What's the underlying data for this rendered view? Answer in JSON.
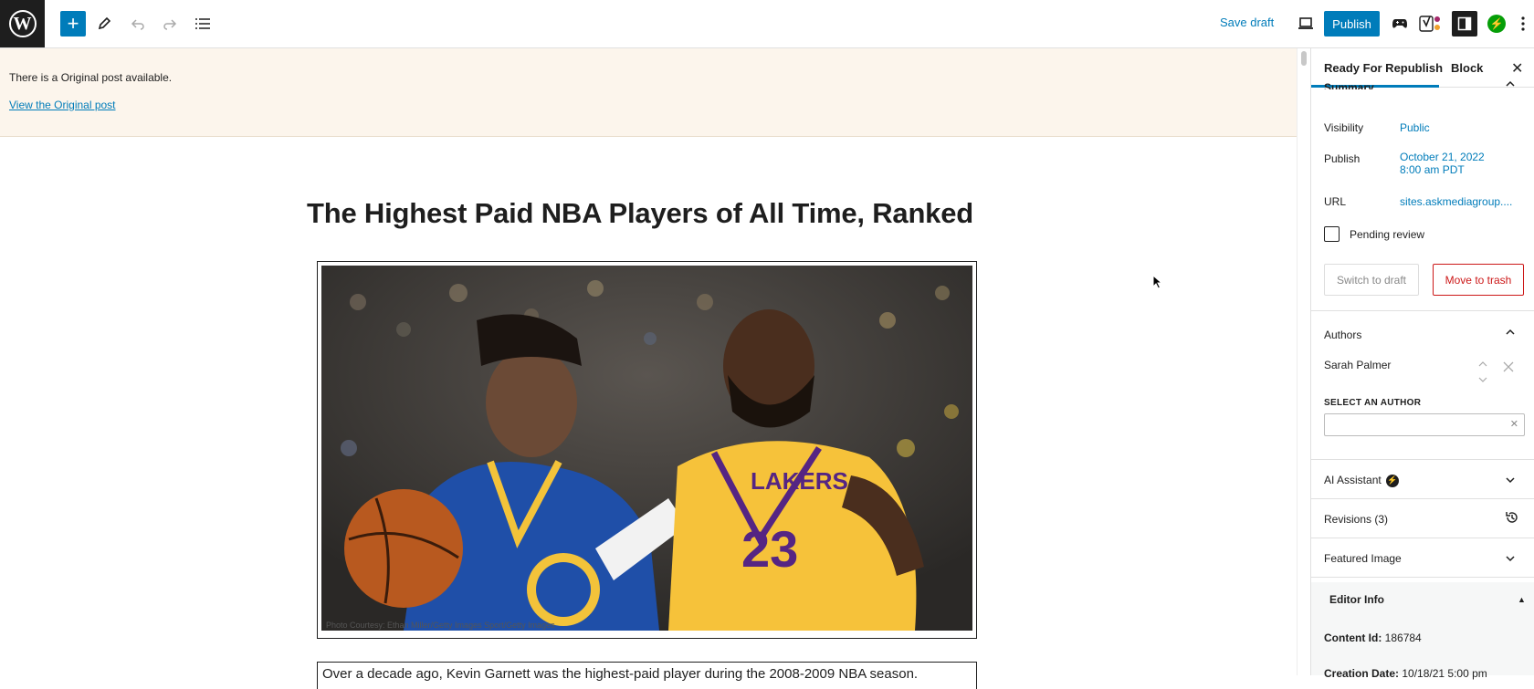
{
  "toolbar": {
    "logo_text": "W",
    "save_draft_label": "Save draft",
    "publish_label": "Publish",
    "jetpack_glyph": "⚡",
    "icons": [
      "wordpress-logo-icon",
      "add-block-icon",
      "edit-tools-icon",
      "undo-icon",
      "redo-icon",
      "document-overview-icon",
      "preview-icon",
      "game-controller-icon",
      "yoast-icon",
      "settings-sidebar-icon",
      "jetpack-icon",
      "more-options-icon"
    ]
  },
  "notice": {
    "message": "There is a Original post available.",
    "link": "View the Original post"
  },
  "post": {
    "title": "The Highest Paid NBA Players of All Time, Ranked",
    "image_caption": "Photo Courtesy: Ethan Miller/Getty Images Sport/Getty Images",
    "paragraph": "Over a decade ago, Kevin Garnett was the highest-paid player during the 2008-2009 NBA season."
  },
  "sidebar": {
    "tabs": [
      "Ready For Republish",
      "Block"
    ],
    "close_glyph": "✕",
    "summary_title": "Summary",
    "visibility_label": "Visibility",
    "visibility_value": "Public",
    "publish_label": "Publish",
    "publish_date": "October 21, 2022",
    "publish_time": "8:00 am PDT",
    "url_label": "URL",
    "url_value": "sites.askmediagroup....",
    "pending_review_label": "Pending review",
    "switch_to_draft_label": "Switch to draft",
    "move_to_trash_label": "Move to trash",
    "authors_title": "Authors",
    "author_name": "Sarah Palmer",
    "select_author_label": "SELECT AN AUTHOR",
    "ai_assistant_title": "AI Assistant",
    "revisions_title": "Revisions (3)",
    "featured_image_title": "Featured Image",
    "editor_info_title": "Editor Info",
    "content_id_label": "Content Id:",
    "content_id_value": "186784",
    "creation_date_label": "Creation Date:",
    "creation_date_value": "10/18/21 5:00 pm"
  },
  "colors": {
    "accent": "#007cba",
    "danger": "#cc1818",
    "notice_bg": "#fcf5ec",
    "jetpack_green": "#069e08"
  }
}
